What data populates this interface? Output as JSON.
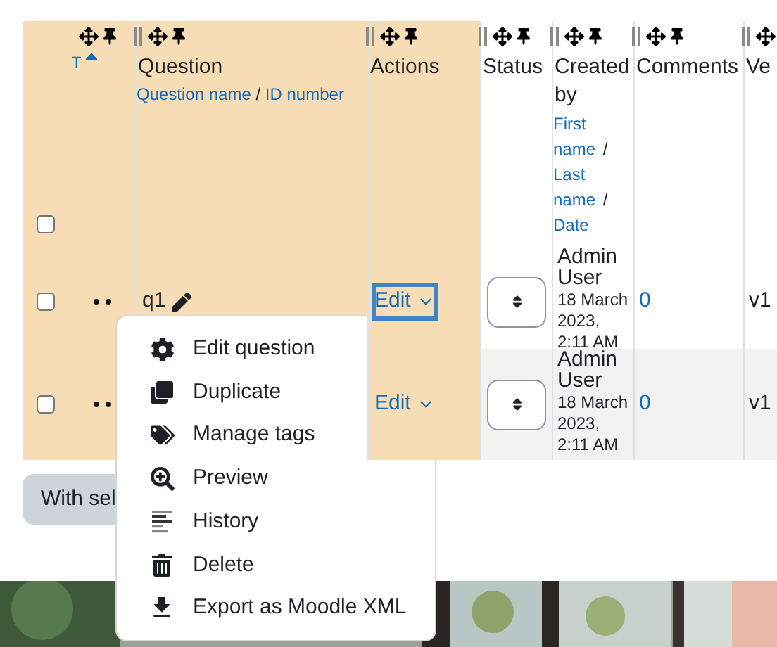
{
  "table": {
    "select_all": {
      "checked": false
    },
    "columns": [
      {
        "label": "T",
        "sorted": true,
        "resizable": false
      },
      {
        "label": "Question",
        "sorted": false,
        "resizable": true,
        "links": [
          "Question name",
          "ID number"
        ],
        "separator": "/"
      },
      {
        "label": "Actions",
        "sorted": false,
        "resizable": true
      },
      {
        "label": "Status",
        "sorted": false,
        "resizable": true
      },
      {
        "label": "Created by",
        "sorted": false,
        "resizable": true,
        "links": [
          "First name",
          "Last name",
          "Date"
        ],
        "separator": "/"
      },
      {
        "label": "Comments",
        "sorted": false,
        "resizable": true
      },
      {
        "label": "Ve",
        "sorted": false,
        "resizable": true
      }
    ],
    "rows": [
      {
        "checked": false,
        "question": "q1",
        "action": "Edit",
        "focused": true,
        "created_by": "Admin User",
        "created_date": "18 March 2023, 2:11 AM",
        "comments": "0",
        "version": "v1"
      },
      {
        "checked": false,
        "action": "Edit",
        "focused": false,
        "created_by": "Admin User",
        "created_date": "18 March 2023, 2:11 AM",
        "comments": "0",
        "version": "v1"
      }
    ]
  },
  "bulk_button": "With sel",
  "action_menu": {
    "items": [
      "Edit question",
      "Duplicate",
      "Manage tags",
      "Preview",
      "History",
      "Delete",
      "Export as Moodle XML"
    ]
  }
}
